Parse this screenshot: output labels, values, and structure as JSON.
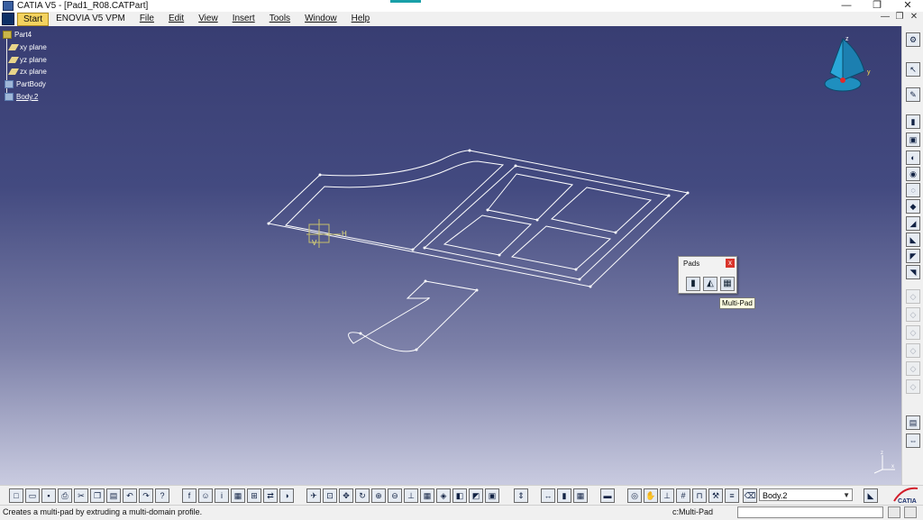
{
  "window": {
    "title": "CATIA V5 - [Pad1_R08.CATPart]",
    "controls": [
      "—",
      "❐",
      "✕"
    ]
  },
  "menubar": {
    "items": [
      "Start",
      "ENOVIA V5 VPM",
      "File",
      "Edit",
      "View",
      "Insert",
      "Tools",
      "Window",
      "Help"
    ],
    "doc_controls": [
      "—",
      "❐",
      "✕"
    ]
  },
  "tree": {
    "root": "Part4",
    "children": [
      "xy plane",
      "yz plane",
      "zx plane",
      "PartBody",
      "Body.2"
    ]
  },
  "sketch_axis": {
    "h_label": "H",
    "v_label": "V"
  },
  "compass": {
    "z": "z",
    "y": "y",
    "x": "x"
  },
  "axis_triad": {
    "z": "z",
    "x": "x"
  },
  "pads_toolbar": {
    "title": "Pads",
    "close": "x",
    "buttons": [
      "pad-icon",
      "drafted-filleted-pad-icon",
      "multi-pad-icon"
    ]
  },
  "tooltip": "Multi-Pad",
  "body_selector": {
    "value": "Body.2"
  },
  "status": {
    "message": "Creates a multi-pad by extruding a multi-domain profile.",
    "command": "c:Multi-Pad"
  },
  "colors": {
    "background_top": "#383d72",
    "background_bottom": "#c9cbe0",
    "wireframe": "#ffffff",
    "highlight": "#f4d35f"
  }
}
